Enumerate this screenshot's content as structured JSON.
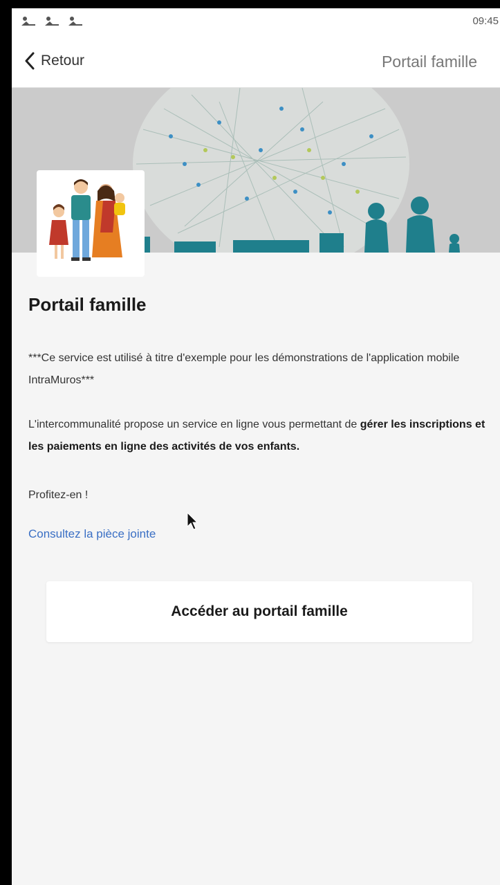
{
  "status_bar": {
    "time": "09:45",
    "notification_icons": [
      "notification-icon",
      "notification-icon",
      "notification-icon"
    ]
  },
  "nav": {
    "back_label": "Retour",
    "title": "Portail famille"
  },
  "content": {
    "title": "Portail famille",
    "demo_notice": "***Ce service est utilisé à titre d'exemple pour les démonstrations de l'application mobile IntraMuros***",
    "intro_text": "L'intercommunalité propose un service en ligne vous permettant de ",
    "intro_bold": "gérer les inscriptions et les paiements en ligne des activités de vos enfants.",
    "closing": "Profitez-en !",
    "attachment_link": "Consultez la pièce jointe",
    "cta_label": "Accéder au portail famille"
  },
  "colors": {
    "link": "#3a6fc4",
    "banner_silhouette": "#1f7f8c",
    "background": "#f5f5f5"
  }
}
